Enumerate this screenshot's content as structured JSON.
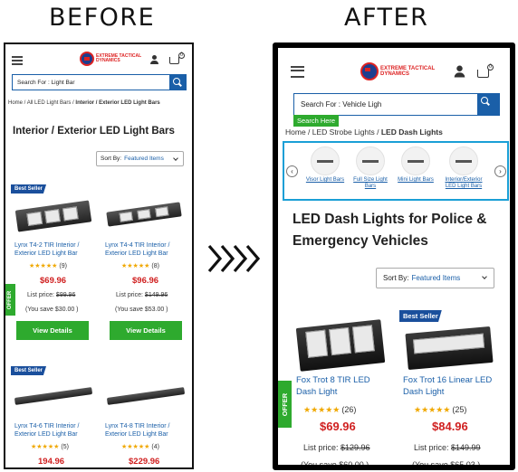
{
  "headings": {
    "before": "BEFORE",
    "after": "AFTER"
  },
  "logo_text": [
    "EXTREME TACTICAL",
    "DYNAMICS"
  ],
  "before": {
    "cart_count": "0",
    "search_value": "Search For :  Light Bar",
    "breadcrumb": [
      "Home",
      "All LED Light Bars",
      "Interior / Exterior LED Light Bars"
    ],
    "title": "Interior / Exterior LED Light Bars",
    "sort_label": "Sort By:",
    "sort_value": "Featured Items",
    "offer_label": "OFFER",
    "products": [
      {
        "badge": "Best Seller",
        "name": "Lynx T4-2 TIR Interior / Exterior LED Light Bar",
        "stars": "★★★★★",
        "reviews": "(9)",
        "price": "$69.96",
        "list_label": "List price:",
        "list_price": "$99.96",
        "save": "(You save $30.00 )",
        "cta": "View Details"
      },
      {
        "badge": "",
        "name": "Lynx T4-4 TIR Interior / Exterior LED Light Bar",
        "stars": "★★★★★",
        "reviews": "(8)",
        "price": "$96.96",
        "list_label": "List price:",
        "list_price": "$149.96",
        "save": "(You save $53.00 )",
        "cta": "View Details"
      },
      {
        "badge": "Best Seller",
        "name": "Lynx T4-6 TIR Interior / Exterior LED Light Bar",
        "stars": "★★★★★",
        "reviews": "(5)",
        "price": "194.96"
      },
      {
        "badge": "",
        "name": "Lynx T4-8 TIR Interior / Exterior LED Light Bar",
        "stars": "★★★★★",
        "reviews": "(4)",
        "price": "$229.96"
      }
    ]
  },
  "after": {
    "cart_count": "0",
    "search_value": "Search For :  Vehicle Ligh",
    "search_tooltip": "Search Here",
    "breadcrumb": [
      "Home",
      "LED Strobe Lights",
      "LED Dash Lights"
    ],
    "categories": [
      "Visor Light Bars",
      "Full Size Light Bars",
      "Mini Light Bars",
      "Interior/Exterior LED Light Bars"
    ],
    "title": "LED Dash Lights for Police & Emergency Vehicles",
    "sort_label": "Sort By:",
    "sort_value": "Featured Items",
    "offer_label": "OFFER",
    "products": [
      {
        "badge": "",
        "name": "Fox Trot 8 TIR LED Dash Light",
        "stars": "★★★★★",
        "reviews": "(26)",
        "price": "$69.96",
        "list_label": "List price:",
        "list_price": "$129.96",
        "save": "(You save $60.00 )"
      },
      {
        "badge": "Best Seller",
        "name": "Fox Trot 16 Linear LED Dash Light",
        "stars": "★★★★★",
        "reviews": "(25)",
        "price": "$84.96",
        "list_label": "List price:",
        "list_price": "$149.99",
        "save": "(You save $65.03 )"
      }
    ]
  },
  "colors": {
    "accent": "#1a5fa8",
    "price": "#d02020",
    "cta": "#2eaa2e",
    "badge": "#1a4f9c",
    "carousel_border": "#1a9fd6"
  }
}
